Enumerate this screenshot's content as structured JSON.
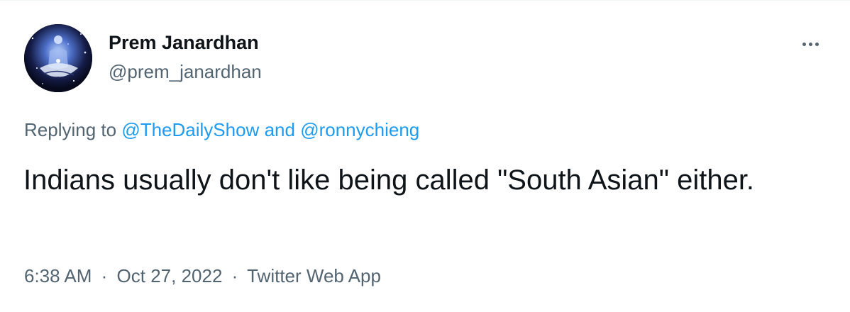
{
  "author": {
    "display_name": "Prem Janardhan",
    "handle": "@prem_janardhan"
  },
  "more_menu_icon": "ellipsis-icon",
  "reply_context": {
    "prefix": "Replying to",
    "mention_1": "@TheDailyShow",
    "conjunction": "and",
    "mention_2": "@ronnychieng"
  },
  "tweet": {
    "text": "Indians usually don't like being called \"South Asian\" either."
  },
  "meta": {
    "time": "6:38 AM",
    "separator": "·",
    "date": "Oct 27, 2022",
    "source": "Twitter Web App"
  },
  "colors": {
    "text_primary": "#0f1419",
    "text_secondary": "#536471",
    "link": "#1d9bf0",
    "background": "#ffffff"
  }
}
